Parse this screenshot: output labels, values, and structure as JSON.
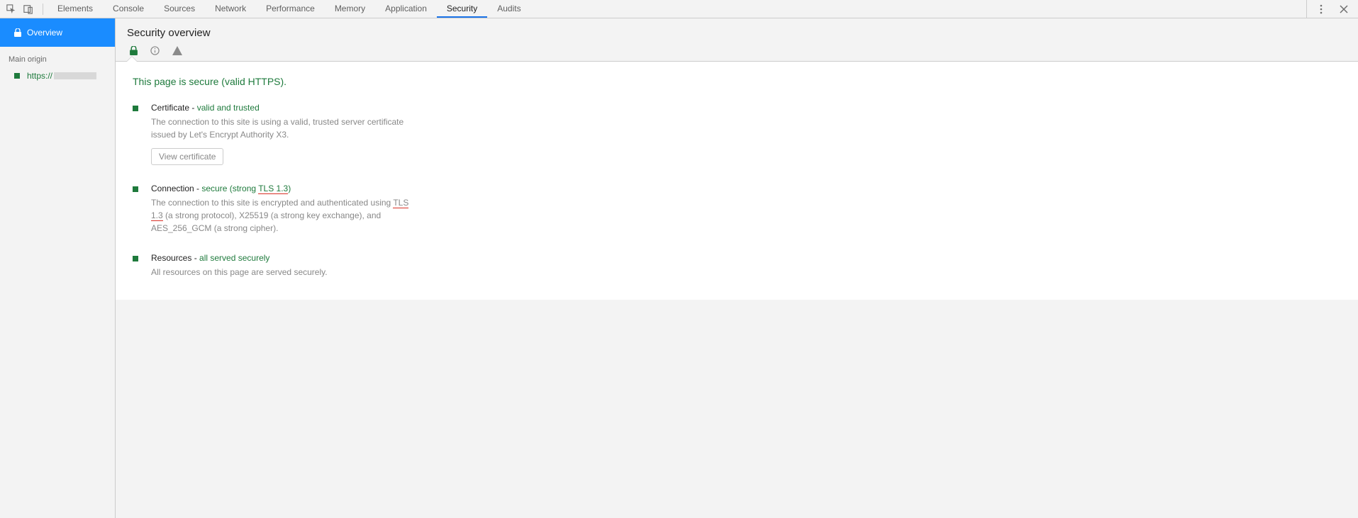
{
  "toolbar": {
    "tabs": [
      {
        "label": "Elements"
      },
      {
        "label": "Console"
      },
      {
        "label": "Sources"
      },
      {
        "label": "Network"
      },
      {
        "label": "Performance"
      },
      {
        "label": "Memory"
      },
      {
        "label": "Application"
      },
      {
        "label": "Security",
        "active": true
      },
      {
        "label": "Audits"
      }
    ]
  },
  "sidebar": {
    "overview_label": "Overview",
    "main_origin_label": "Main origin",
    "origin_prefix": "https://"
  },
  "main": {
    "title": "Security overview",
    "headline": "This page is secure (valid HTTPS).",
    "certificate": {
      "title_prefix": "Certificate - ",
      "title_status": "valid and trusted",
      "desc": "The connection to this site is using a valid, trusted server certificate issued by Let's Encrypt Authority X3.",
      "button": "View certificate"
    },
    "connection": {
      "title_prefix": "Connection - ",
      "title_status_pre": "secure (strong ",
      "title_tls": "TLS 1.3",
      "title_status_post": ")",
      "desc_pre": "The connection to this site is encrypted and authenticated using ",
      "desc_tls": "TLS 1.3",
      "desc_post": " (a strong protocol), X25519 (a strong key exchange), and AES_256_GCM (a strong cipher)."
    },
    "resources": {
      "title_prefix": "Resources - ",
      "title_status": "all served securely",
      "desc": "All resources on this page are served securely."
    }
  }
}
